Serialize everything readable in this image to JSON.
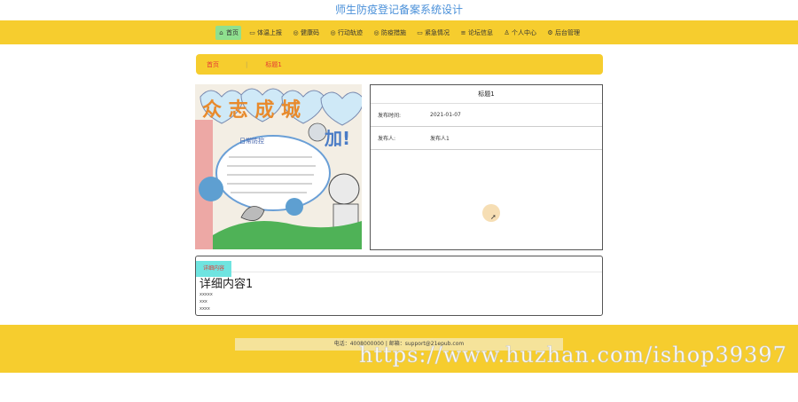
{
  "site": {
    "title": "师生防疫登记备案系统设计"
  },
  "nav": {
    "items": [
      {
        "icon": "⌂",
        "label": "首页",
        "active": true
      },
      {
        "icon": "▭",
        "label": "体温上报"
      },
      {
        "icon": "◎",
        "label": "健康码"
      },
      {
        "icon": "◎",
        "label": "行动轨迹"
      },
      {
        "icon": "◎",
        "label": "防疫措施"
      },
      {
        "icon": "▭",
        "label": "紧急情况"
      },
      {
        "icon": "≡",
        "label": "论坛信息"
      },
      {
        "icon": "♙",
        "label": "个人中心"
      },
      {
        "icon": "⚙",
        "label": "后台管理"
      }
    ]
  },
  "breadcrumb": {
    "home": "首页",
    "separator": "|",
    "current": "标题1"
  },
  "info": {
    "title": "标题1",
    "publish_time_label": "发布时间:",
    "publish_time": "2021-01-07",
    "publisher_label": "发布人:",
    "publisher": "发布人1"
  },
  "detail": {
    "tab": "详细内容",
    "heading": "详细内容1",
    "lines": [
      "xxxxx",
      "xxx",
      "xxxx"
    ]
  },
  "footer": {
    "contact": "电话：4008000000 | 邮箱：support@21epub.com"
  },
  "watermark": "https://www.huzhan.com/ishop39397",
  "image_text": {
    "banner": "众 志 成 城",
    "subtitle": "日常防控",
    "shout": "加!"
  }
}
